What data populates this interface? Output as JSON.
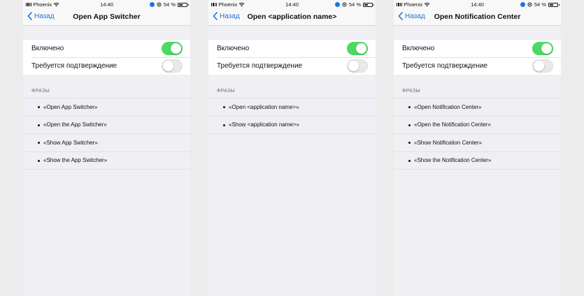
{
  "screens": [
    {
      "status": {
        "carrier": "Phoenix",
        "time": "14:40",
        "battery": "54 %",
        "battery_level": 0.54
      },
      "nav": {
        "back": "Назад",
        "title": "Open App Switcher"
      },
      "settings": {
        "enabled_label": "Включено",
        "enabled_on": true,
        "confirm_label": "Требуется подтверждение",
        "confirm_on": false
      },
      "phrases_header": "ФРАЗЫ",
      "phrases": [
        "«Open App Switcher»",
        "«Open the App Switcher»",
        "«Show App Switcher»",
        "«Show the App Switcher»"
      ]
    },
    {
      "status": {
        "carrier": "Phoenix",
        "time": "14:40",
        "battery": "54 %",
        "battery_level": 0.54
      },
      "nav": {
        "back": "Назад",
        "title": "Open <application name>"
      },
      "settings": {
        "enabled_label": "Включено",
        "enabled_on": true,
        "confirm_label": "Требуется подтверждение",
        "confirm_on": false
      },
      "phrases_header": "ФРАЗЫ",
      "phrases": [
        "«Open <application name>»",
        "«Show <application name>»"
      ]
    },
    {
      "status": {
        "carrier": "Phoenix",
        "time": "14:40",
        "battery": "54 %",
        "battery_level": 0.54
      },
      "nav": {
        "back": "Назад",
        "title": "Open Notification Center"
      },
      "settings": {
        "enabled_label": "Включено",
        "enabled_on": true,
        "confirm_label": "Требуется подтверждение",
        "confirm_on": false
      },
      "phrases_header": "ФРАЗЫ",
      "phrases": [
        "«Open Notification Center»",
        "«Open the Notification Center»",
        "«Show Notification Center»",
        "«Show the Notification Center»"
      ]
    }
  ],
  "colors": {
    "accent": "#1e73d2",
    "switch_on": "#4cd964",
    "switch_off": "#e9e9ea",
    "background": "#efeff4"
  },
  "icons": {
    "back": "chevron-left-icon",
    "wifi": "wifi-icon",
    "bluetooth": "bluetooth-icon",
    "orientation_lock": "orientation-lock-icon",
    "battery": "battery-icon"
  }
}
